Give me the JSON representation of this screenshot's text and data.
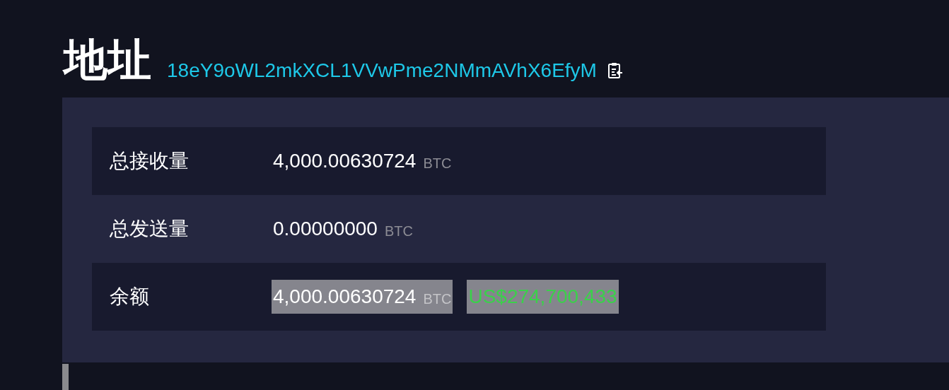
{
  "header": {
    "title": "地址",
    "address": "18eY9oWL2mkXCL1VVwPme2NMmAVhX6EfyM"
  },
  "rows": [
    {
      "label": "总接收量",
      "amount": "4,000.00630724",
      "unit": "BTC",
      "striped": true,
      "highlighted": false
    },
    {
      "label": "总发送量",
      "amount": "0.00000000",
      "unit": "BTC",
      "striped": false,
      "highlighted": false
    },
    {
      "label": "余额",
      "amount": "4,000.00630724",
      "unit": "BTC",
      "usd": "US$274,700,433",
      "striped": true,
      "highlighted": true
    }
  ]
}
